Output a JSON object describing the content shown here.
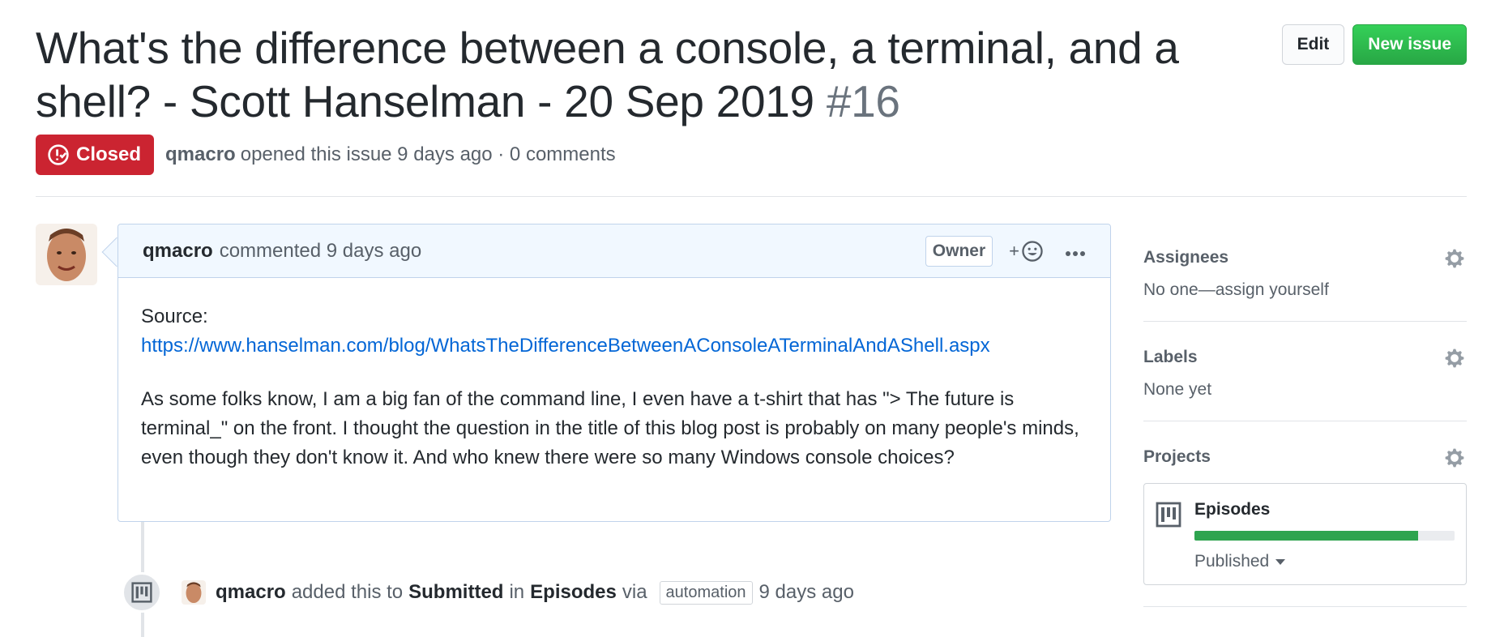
{
  "issue": {
    "title": "What's the difference between a console, a terminal, and a shell? - Scott Hanselman - 20 Sep 2019",
    "number": "#16",
    "state": "Closed",
    "state_color": "#cb2431",
    "author": "qmacro",
    "opened_text": "opened this issue 9 days ago · 0 comments"
  },
  "header_actions": {
    "edit_label": "Edit",
    "new_issue_label": "New issue"
  },
  "comment": {
    "author": "qmacro",
    "meta": "commented 9 days ago",
    "role_badge": "Owner",
    "reaction_plus": "+",
    "body_source_label": "Source:",
    "body_link": "https://www.hanselman.com/blog/WhatsTheDifferenceBetweenAConsoleATerminalAndAShell.aspx",
    "body_text": "As some folks know, I am a big fan of the command line, I even have a t-shirt that has \"> The future is terminal_\" on the front. I thought the question in the title of this blog post is probably on many people's minds, even though they don't know it. And who knew there were so many Windows console choices?"
  },
  "event": {
    "actor": "qmacro",
    "text1": "added this to",
    "column": "Submitted",
    "text2": "in",
    "project": "Episodes",
    "text3": "via",
    "via": "automation",
    "time": "9 days ago"
  },
  "sidebar": {
    "assignees": {
      "title": "Assignees",
      "value": "No one—assign yourself"
    },
    "labels": {
      "title": "Labels",
      "value": "None yet"
    },
    "projects": {
      "title": "Projects",
      "card": {
        "name": "Episodes",
        "status": "Published",
        "progress_fraction": 0.86
      }
    }
  },
  "colors": {
    "primary_green": "#2ea44f",
    "link_blue": "#0366d6",
    "comment_header_bg": "#f1f8ff"
  }
}
